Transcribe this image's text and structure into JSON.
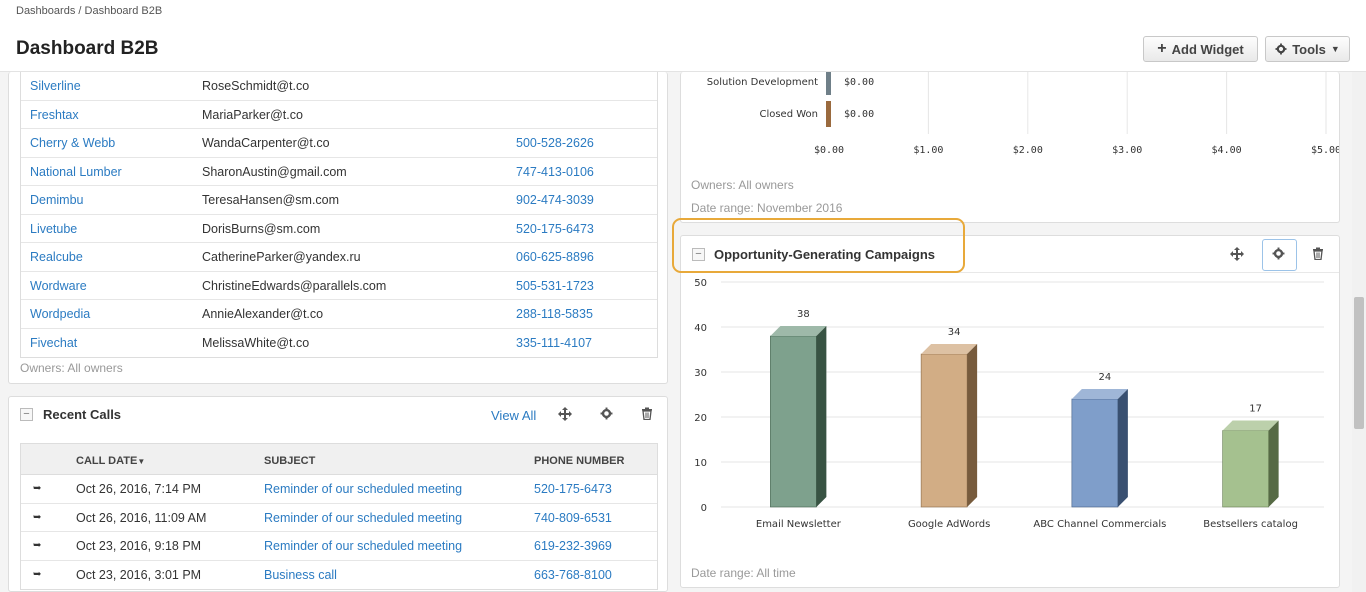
{
  "breadcrumb": {
    "root": "Dashboards",
    "sep": "/",
    "current": "Dashboard B2B"
  },
  "title": "Dashboard B2B",
  "buttons": {
    "add_widget": "Add Widget",
    "tools": "Tools"
  },
  "contacts": {
    "rows": [
      {
        "company": "Silverline",
        "email": "RoseSchmidt@t.co",
        "phone": ""
      },
      {
        "company": "Freshtax",
        "email": "MariaParker@t.co",
        "phone": ""
      },
      {
        "company": "Cherry & Webb",
        "email": "WandaCarpenter@t.co",
        "phone": "500-528-2626"
      },
      {
        "company": "National Lumber",
        "email": "SharonAustin@gmail.com",
        "phone": "747-413-0106"
      },
      {
        "company": "Demimbu",
        "email": "TeresaHansen@sm.com",
        "phone": "902-474-3039"
      },
      {
        "company": "Livetube",
        "email": "DorisBurns@sm.com",
        "phone": "520-175-6473"
      },
      {
        "company": "Realcube",
        "email": "CatherineParker@yandex.ru",
        "phone": "060-625-8896"
      },
      {
        "company": "Wordware",
        "email": "ChristineEdwards@parallels.com",
        "phone": "505-531-1723"
      },
      {
        "company": "Wordpedia",
        "email": "AnnieAlexander@t.co",
        "phone": "288-118-5835"
      },
      {
        "company": "Fivechat",
        "email": "MelissaWhite@t.co",
        "phone": "335-111-4107"
      }
    ],
    "owners_note": "Owners: All owners"
  },
  "recent_calls": {
    "title": "Recent Calls",
    "view_all": "View All",
    "headers": {
      "date": "CALL DATE",
      "subject": "SUBJECT",
      "phone": "PHONE NUMBER"
    },
    "rows": [
      {
        "date": "Oct 26, 2016, 7:14 PM",
        "subject": "Reminder of our scheduled meeting",
        "phone": "520-175-6473"
      },
      {
        "date": "Oct 26, 2016, 11:09 AM",
        "subject": "Reminder of our scheduled meeting",
        "phone": "740-809-6531"
      },
      {
        "date": "Oct 23, 2016, 9:18 PM",
        "subject": "Reminder of our scheduled meeting",
        "phone": "619-232-3969"
      },
      {
        "date": "Oct 23, 2016, 3:01 PM",
        "subject": "Business call",
        "phone": "663-768-8100"
      }
    ]
  },
  "pipeline": {
    "owners_note": "Owners: All owners",
    "date_note": "Date range: November 2016"
  },
  "campaigns": {
    "title": "Opportunity-Generating Campaigns",
    "date_note": "Date range: All time"
  },
  "chart_data": [
    {
      "type": "bar",
      "orientation": "horizontal",
      "categories": [
        "Solution Development",
        "Closed Won"
      ],
      "values": [
        0,
        0
      ],
      "value_labels": [
        "$0.00",
        "$0.00"
      ],
      "x_ticks": [
        "$0.00",
        "$1.00",
        "$2.00",
        "$3.00",
        "$4.00",
        "$5.00"
      ],
      "xlim": [
        0,
        5
      ],
      "colors": [
        "#6f7f88",
        "#9a6a3e"
      ],
      "grid": true
    },
    {
      "type": "bar",
      "categories": [
        "Email Newsletter",
        "Google AdWords",
        "ABC Channel Commercials",
        "Bestsellers catalog"
      ],
      "values": [
        38,
        34,
        24,
        17
      ],
      "y_ticks": [
        "50",
        "40",
        "30",
        "20",
        "10",
        "0"
      ],
      "ylim": [
        0,
        50
      ],
      "colors": [
        "#5e8a70",
        "#c79866",
        "#5f86bd",
        "#8fb173"
      ],
      "grid": true
    }
  ]
}
